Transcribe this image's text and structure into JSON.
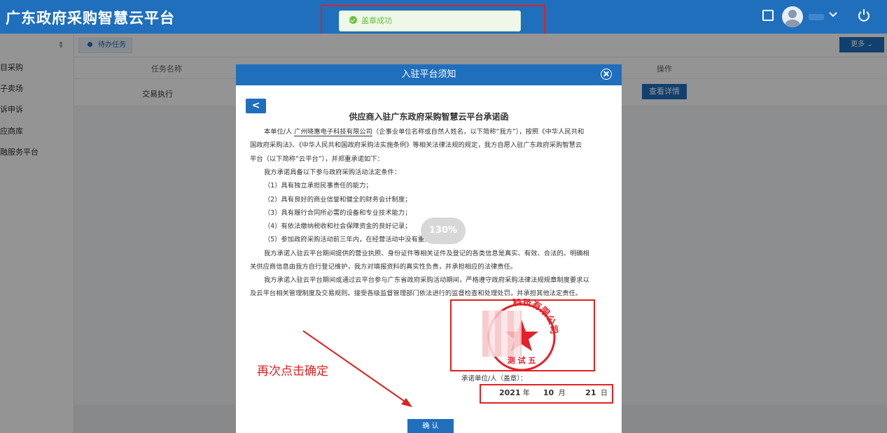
{
  "app": {
    "title": "广东政府采购智慧云平台"
  },
  "toast": {
    "message": "盖章成功"
  },
  "sidebar": {
    "items": [
      "目采购",
      "子卖场",
      "诉申诉",
      "应商库",
      "融服务平台"
    ]
  },
  "tabs": {
    "active": "待办任务",
    "more": "更多"
  },
  "table": {
    "headers": [
      "任务名称",
      "操作"
    ],
    "row": {
      "task": "交易执行",
      "action": "查看详情"
    }
  },
  "modal": {
    "title": "入驻平台须知",
    "back_label": "<",
    "doc_title": "供应商入驻广东政府采购智慧云平台承诺函",
    "company": "广州晓惠电子科技有限公司",
    "lines": [
      "（企事业单位名称或自然人姓名，以下简称“我方”），按照《中华人民共和",
      "国政府采购法》、《中华人民共和国政府采购法实施条例》等相关法律法规的规定，我方自愿入驻广东政府采购智慧云",
      "平台（以下简称“云平台”），并郑重承诺如下：",
      "我方承诺具备以下参与政府采购活动法定条件：",
      "（1）具有独立承担民事责任的能力；",
      "（2）具有良好的商业信誉和健全的财务会计制度；",
      "（3）具有履行合同所必需的设备和专业技术能力；",
      "（4）有依法缴纳税收和社会保障资金的良好记录；",
      "（5）参加政府采购活动前三年内，在经营活动中没有重大违法记录。",
      "我方承诺入驻云平台期间提供的营业执照、身份证件等相关证件及登记的各类信息是真实、有效、合法的。明确相",
      "关供应商信息由我方自行登记维护，我方对填报资料的真实性负责，并承担相应的法律责任。",
      "我方承诺入驻云平台期间或通过云平台参与广东省政府采购活动期间，严格遵守政府采购法律法规规章制度要求以",
      "及云平台相关管理制度及交易规则。接受各级监督管理部门依法进行的监督检查和处理处罚，并承担其他法定责任。"
    ],
    "prefix": "本单位/人",
    "zoom": "130%",
    "seal_top_text": "科技有限公司",
    "seal_bottom_text": "测试五",
    "sign_label": "承诺单位/人（盖章）：",
    "date": {
      "year": "2021",
      "year_unit": "年",
      "month": "10",
      "month_unit": "月",
      "day": "21",
      "day_unit": "日"
    },
    "confirm": "确 认"
  },
  "annotation": {
    "text": "再次点击确定"
  },
  "colors": {
    "primary": "#1f6fbd",
    "annotation": "#e0221f",
    "success": "#67c23a"
  }
}
